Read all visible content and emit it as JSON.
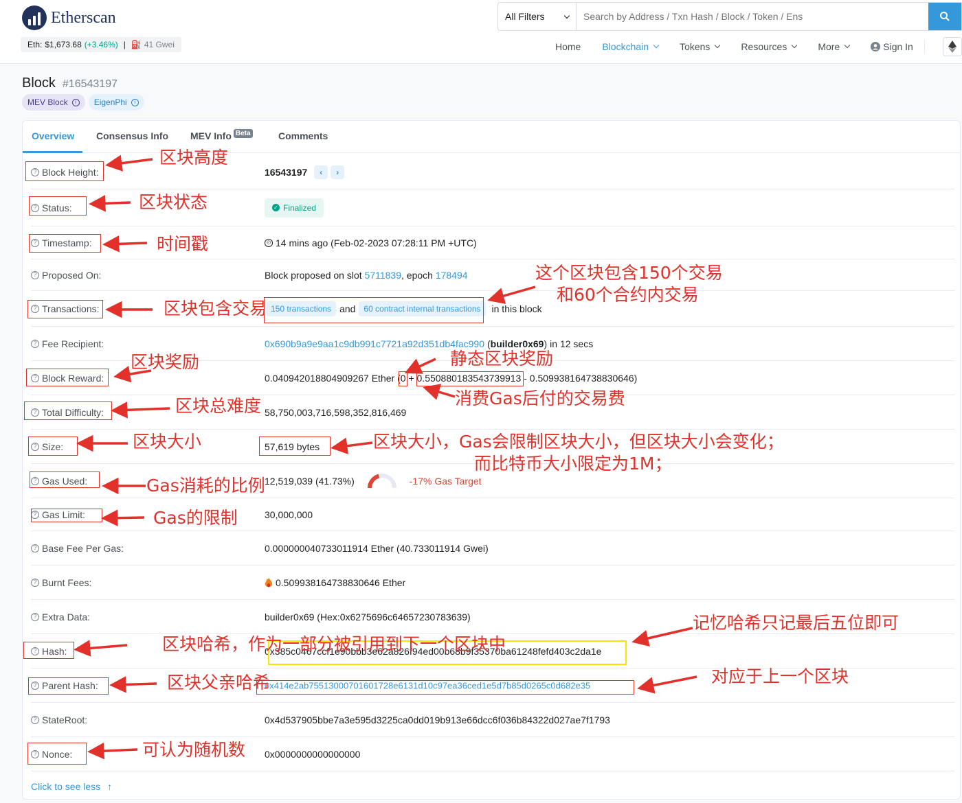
{
  "header": {
    "logo_text": "Etherscan",
    "eth_price_label": "Eth:",
    "eth_price": "$1,673.68",
    "eth_change": "(+3.46%)",
    "separator": "|",
    "gas": "41 Gwei",
    "search": {
      "filter_label": "All Filters",
      "placeholder": "Search by Address / Txn Hash / Block / Token / Ens"
    },
    "nav": {
      "home": "Home",
      "blockchain": "Blockchain",
      "tokens": "Tokens",
      "resources": "Resources",
      "more": "More",
      "sign_in": "Sign In"
    }
  },
  "page": {
    "title": "Block",
    "block_number": "#16543197",
    "badges": {
      "mev": "MEV Block",
      "eigen": "EigenPhi"
    }
  },
  "tabs": {
    "overview": "Overview",
    "consensus": "Consensus Info",
    "mev": "MEV Info",
    "beta": "Beta",
    "comments": "Comments"
  },
  "rows": {
    "block_height": {
      "label": "Block Height:",
      "value": "16543197"
    },
    "status": {
      "label": "Status:",
      "value": "Finalized"
    },
    "timestamp": {
      "label": "Timestamp:",
      "value": "14 mins ago (Feb-02-2023 07:28:11 PM +UTC)"
    },
    "proposed": {
      "label": "Proposed On:",
      "prefix": "Block proposed on slot",
      "slot": "5711839",
      "mid": ", epoch",
      "epoch": "178494"
    },
    "transactions": {
      "label": "Transactions:",
      "tx": "150 transactions",
      "and": "and",
      "internal": "60 contract internal transactions",
      "suffix": "in this block"
    },
    "fee_recipient": {
      "label": "Fee Recipient:",
      "address": "0x690b9a9e9aa1c9db991c7721a92d351db4fac990",
      "name": "builder0x69",
      "suffix": "in 12 secs"
    },
    "block_reward": {
      "label": "Block Reward:",
      "value": "0.040942018804909267 Ether",
      "open": "(",
      "static": "0",
      "plus": "+",
      "fees": "0.550880183543739913",
      "minus": "- 0.509938164738830646)"
    },
    "total_difficulty": {
      "label": "Total Difficulty:",
      "value": "58,750,003,716,598,352,816,469"
    },
    "size": {
      "label": "Size:",
      "value": "57,619 bytes"
    },
    "gas_used": {
      "label": "Gas Used:",
      "value": "12,519,039 (41.73%)",
      "target": "-17% Gas Target",
      "gauge_fraction": 0.4173
    },
    "gas_limit": {
      "label": "Gas Limit:",
      "value": "30,000,000"
    },
    "base_fee": {
      "label": "Base Fee Per Gas:",
      "value": "0.000000040733011914 Ether (40.733011914 Gwei)"
    },
    "burnt_fees": {
      "label": "Burnt Fees:",
      "value": "0.509938164738830646 Ether"
    },
    "extra_data": {
      "label": "Extra Data:",
      "value": "builder0x69 (Hex:0x6275696c64657230783639)"
    },
    "hash": {
      "label": "Hash:",
      "value": "0x385c0467ccf1e90bbb3e62a826f94ed00b68b9f35370ba61248fefd403c2da1e"
    },
    "parent_hash": {
      "label": "Parent Hash:",
      "value": "0x414e2ab75513000701601728e6131d10c97ea36ced1e5d7b85d0265c0d682e35"
    },
    "state_root": {
      "label": "StateRoot:",
      "value": "0x4d537905bbe7a3e595d3225ca0dd019b913e66dcc6f036b84322d027ae7f1793"
    },
    "nonce": {
      "label": "Nonce:",
      "value": "0x0000000000000000"
    }
  },
  "see_less": "Click to see less",
  "annotations": {
    "block_height": "区块高度",
    "status": "区块状态",
    "timestamp": "时间戳",
    "tx_line1": "这个区块包含150个交易",
    "tx_line2": "和60个合约内交易",
    "transactions": "区块包含交易",
    "static_reward": "静态区块奖励",
    "block_reward": "区块奖励",
    "fees": "消费Gas后付的交易费",
    "difficulty": "区块总难度",
    "size": "区块大小",
    "size_line1": "区块大小，Gas会限制区块大小，但区块大小会变化；",
    "size_line2": "而比特币大小限定为1M；",
    "gas_used": "Gas消耗的比例",
    "gas_limit": "Gas的限制",
    "hash_note": "记忆哈希只记最后五位即可",
    "hash": "区块哈希，作为一部分被引用到下一个区块中",
    "parent_hash": "区块父亲哈希",
    "parent_note": "对应于上一个区块",
    "nonce": "可认为随机数"
  },
  "colors": {
    "accent": "#3498db",
    "success": "#00a186",
    "annotation": "#e2312a",
    "highlight": "#f5e800"
  }
}
